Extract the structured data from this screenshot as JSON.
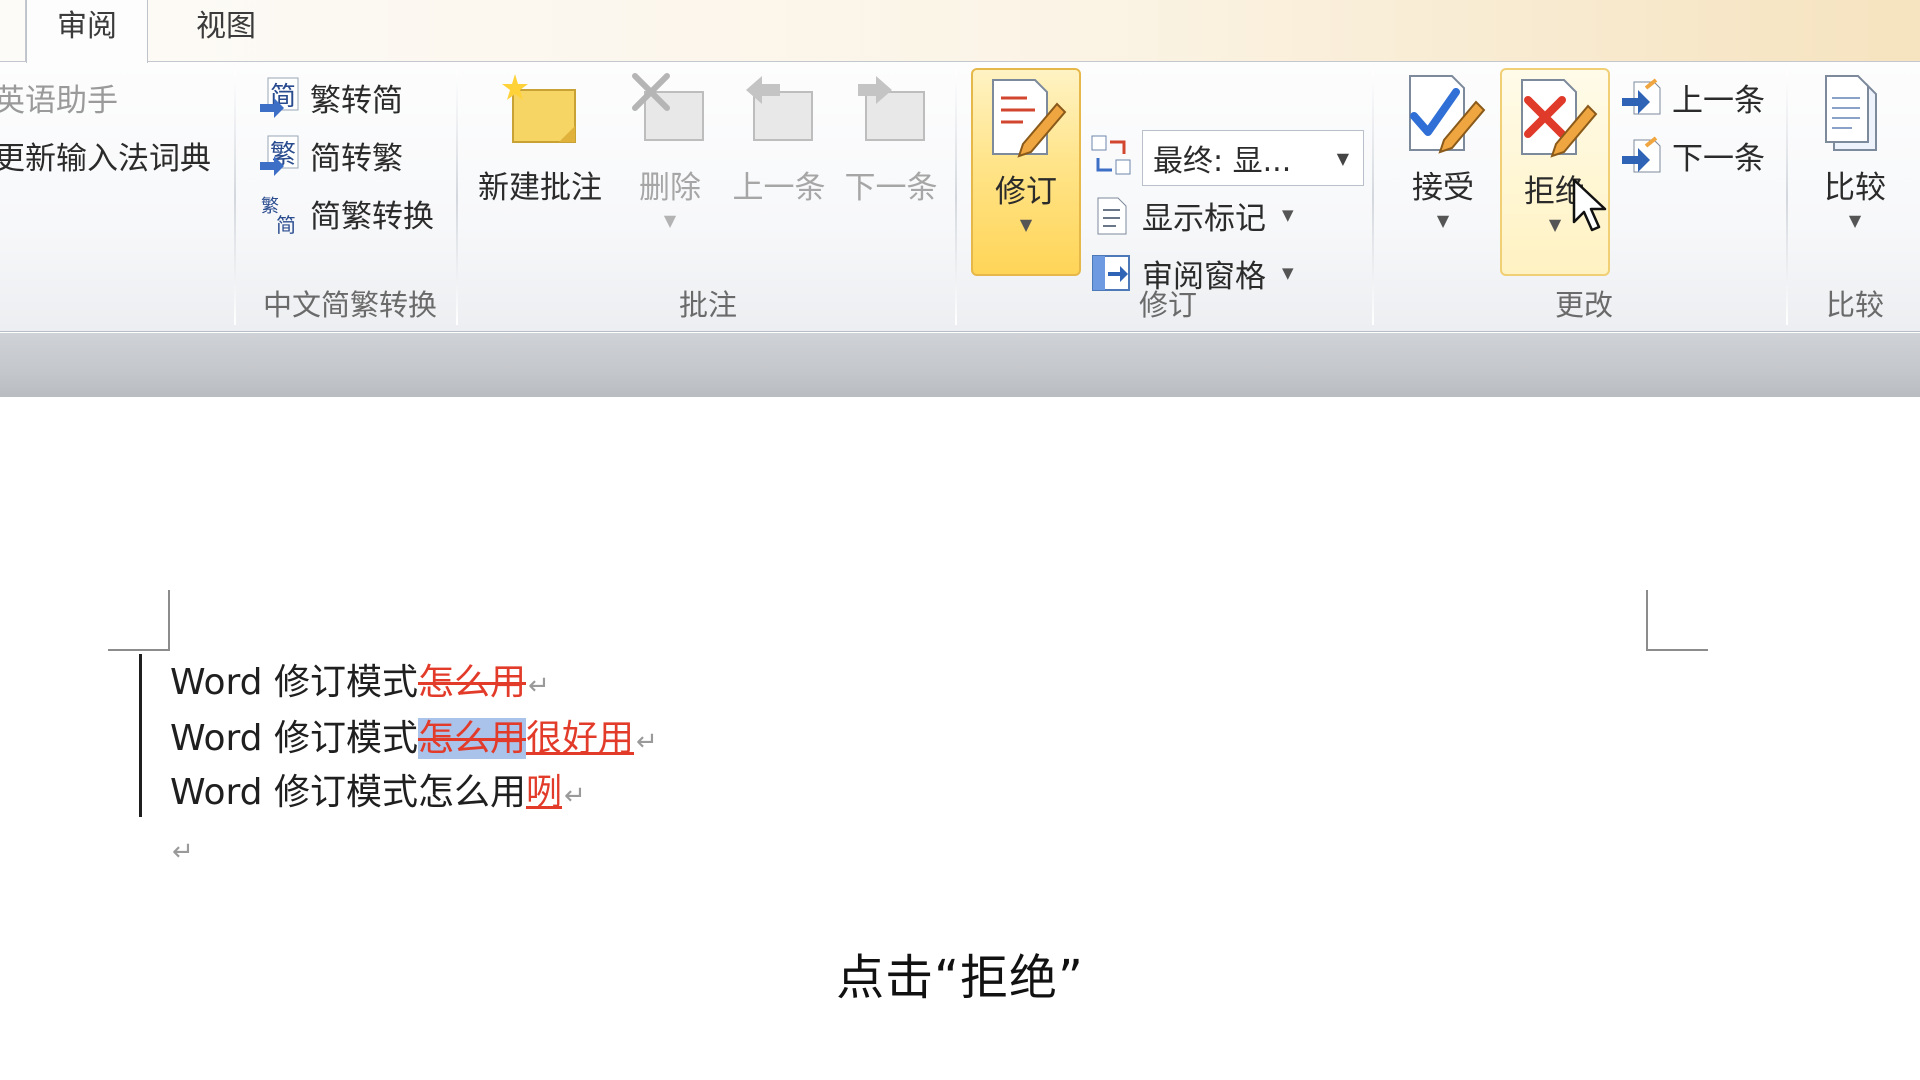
{
  "tabs": [
    {
      "label": "审阅",
      "active": true
    },
    {
      "label": "视图",
      "active": false
    }
  ],
  "ribbon": {
    "partial_left": {
      "items": [
        "英语助手",
        "更新输入法词典"
      ]
    },
    "chinese_conversion": {
      "items": [
        "繁转简",
        "简转繁",
        "简繁转换"
      ],
      "group_label": "中文简繁转换"
    },
    "comments": {
      "buttons": [
        {
          "label": "新建批注",
          "enabled": true
        },
        {
          "label": "删除",
          "enabled": false
        },
        {
          "label": "上一条",
          "enabled": false
        },
        {
          "label": "下一条",
          "enabled": false
        }
      ],
      "group_label": "批注"
    },
    "tracking": {
      "track_changes_label": "修订",
      "display_dropdown_value": "最终: 显...",
      "show_markup_label": "显示标记",
      "reviewing_pane_label": "审阅窗格",
      "group_label": "修订"
    },
    "changes": {
      "accept_label": "接受",
      "reject_label": "拒绝",
      "previous_label": "上一条",
      "next_label": "下一条",
      "group_label": "更改"
    },
    "compare": {
      "compare_label": "比较",
      "group_label": "比较"
    }
  },
  "document": {
    "lines": [
      {
        "base": "Word 修订模式",
        "deleted": "怎么用",
        "selected": "",
        "inserted": "",
        "plain_tail": ""
      },
      {
        "base": "Word 修订模式",
        "deleted": "",
        "selected": "怎么用",
        "inserted": "很好用",
        "plain_tail": ""
      },
      {
        "base": "Word 修订模式怎么用",
        "deleted": "",
        "selected": "",
        "inserted": "咧",
        "plain_tail": ""
      }
    ],
    "paragraph_mark": "↵"
  },
  "caption": "点击“拒绝”",
  "colors": {
    "revision_red": "#e23b2a",
    "selection_blue": "#a9c3ea",
    "highlight_gold": "#ffd558"
  }
}
